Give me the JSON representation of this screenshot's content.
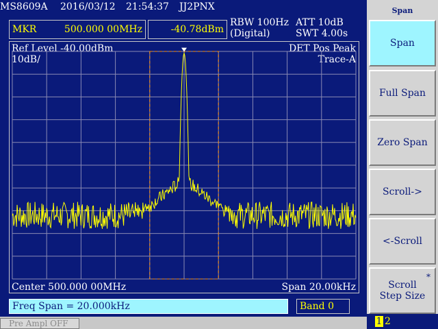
{
  "header": {
    "model": "MS8609A",
    "date": "2016/03/12",
    "time": "21:54:37",
    "callsign": "JJ2PNX"
  },
  "marker": {
    "label": "MKR",
    "freq": "500.000 00MHz",
    "level": "-40.78dBm"
  },
  "readouts": {
    "rbw": "RBW 100Hz",
    "rbw_mode": "(Digital)",
    "att": "ATT 10dB",
    "swt": "SWT 4.00s"
  },
  "screen": {
    "ref_level": "Ref Level -40.00dBm",
    "scale": "10dB/",
    "det": "DET  Pos Peak",
    "trace": "Trace-A",
    "center": "Center 500.000 00MHz",
    "span": "Span 20.00kHz"
  },
  "status": {
    "message": "Freq Span = 20.000kHz",
    "band": "Band 0",
    "preamp": "Pre Ampl OFF"
  },
  "softkeys": {
    "title": "Span",
    "items": [
      {
        "label": "Span",
        "active": true
      },
      {
        "label": "Full Span"
      },
      {
        "label": "Zero Span"
      },
      {
        "label": "Scroll->"
      },
      {
        "label": "<-Scroll"
      },
      {
        "label": "Scroll\nStep Size",
        "star": "*"
      }
    ],
    "page_current": "1",
    "page_next": "2"
  },
  "colors": {
    "background": "#0a1a7a",
    "grid": "#8a8ab4",
    "trace": "#ffff00",
    "window": "#ff8c00",
    "highlight": "#9ef5ff"
  },
  "chart_data": {
    "type": "line",
    "x_center_mhz": 500.0,
    "span_khz": 20.0,
    "ref_level_dbm": -40.0,
    "db_per_div": 10,
    "divisions": 10,
    "peak": {
      "freq_mhz": 500.0,
      "level_dbm": -40.78
    },
    "noise_floor_dbm": -112,
    "window_khz": [
      -2.0,
      2.0
    ]
  }
}
